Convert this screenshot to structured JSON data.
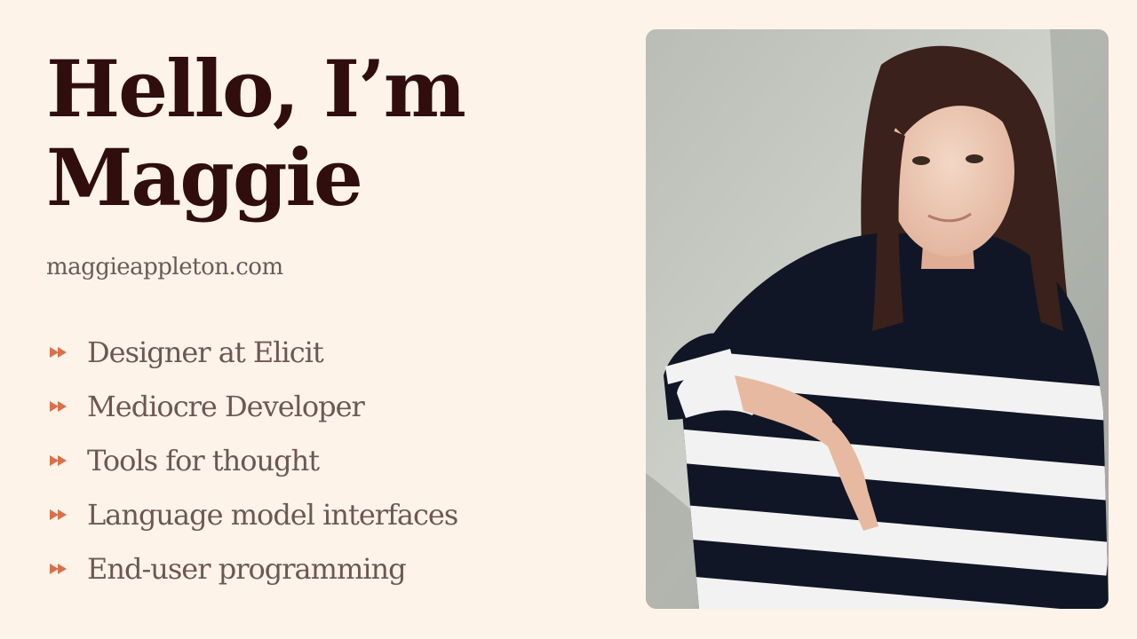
{
  "hero": {
    "title_line1": "Hello, I’m",
    "title_line2": "Maggie",
    "website": "maggieappleton.com"
  },
  "bullets": [
    {
      "icon": "double-arrow-icon",
      "label": "Designer at Elicit"
    },
    {
      "icon": "double-arrow-icon",
      "label": "Mediocre Developer"
    },
    {
      "icon": "double-arrow-icon",
      "label": "Tools for thought"
    },
    {
      "icon": "double-arrow-icon",
      "label": "Language model interfaces"
    },
    {
      "icon": "double-arrow-icon",
      "label": "End-user programming"
    }
  ],
  "colors": {
    "background": "#fdf3e9",
    "title": "#2f0e0d",
    "text": "#6d5754",
    "accent": "#d9704a"
  },
  "photo": {
    "icon": "portrait-photo"
  }
}
